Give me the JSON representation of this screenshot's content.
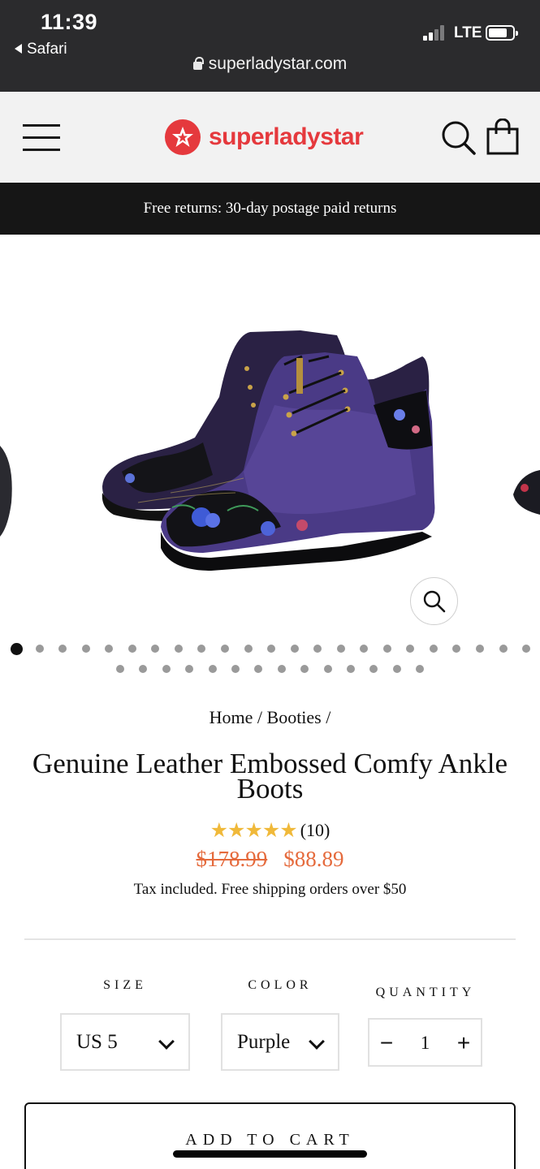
{
  "status_bar": {
    "time": "11:39",
    "back_app": "Safari",
    "network": "LTE",
    "url": "superladystar.com"
  },
  "header": {
    "brand": "superladystar",
    "brand_color": "#e5393d",
    "menu_icon": "hamburger-icon",
    "search_icon": "search-icon",
    "cart_icon": "shopping-bag-icon"
  },
  "announcement": "Free returns: 30-day postage paid returns",
  "gallery": {
    "image": "purple floral embossed leather ankle boots",
    "zoom_icon": "magnifier-icon",
    "dot_count_row1": 23,
    "dot_count_row2": 14,
    "active_index": 0
  },
  "breadcrumb": {
    "home": "Home",
    "sep1": "/",
    "category": "Booties",
    "sep2": "/"
  },
  "product": {
    "title": "Genuine Leather Embossed Comfy Ankle Boots",
    "stars": "★★★★★",
    "rating_value": 5,
    "review_count": "(10)",
    "price_old": "$178.99",
    "price_new": "$88.89",
    "price_color": "#e56a3c",
    "tax_note": "Tax included. Free shipping orders over $50"
  },
  "options": {
    "size_label": "SIZE",
    "size_value": "US 5",
    "color_label": "COLOR",
    "color_value": "Purple",
    "quantity_label": "QUANTITY",
    "quantity_value": "1",
    "minus": "−",
    "plus": "+"
  },
  "cta": {
    "add_to_cart": "ADD TO CART"
  }
}
